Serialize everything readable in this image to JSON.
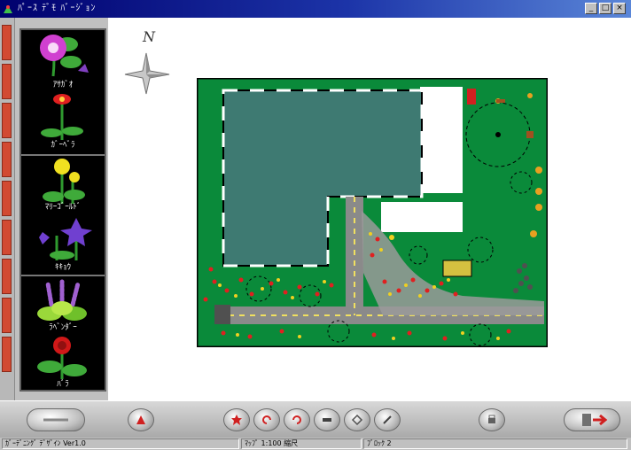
{
  "window": {
    "title": "ﾊﾟｰｽ ﾃﾞﾓ ﾊﾞｰｼﾞｮﾝ",
    "controls": {
      "minimize": "_",
      "maximize": "□",
      "close": "×"
    }
  },
  "palette": {
    "plants": [
      {
        "label": "ｱｻｶﾞｵ",
        "icon": "morning-glory-icon",
        "color": "#d040d0"
      },
      {
        "label": "ｶﾞｰﾍﾞﾗ",
        "icon": "gerbera-icon",
        "color": "#e02020"
      },
      {
        "label": "ﾏﾘｰｺﾞｰﾙﾄﾞ",
        "icon": "marigold-icon",
        "color": "#f0e020"
      },
      {
        "label": "ｷｷｮｳ",
        "icon": "bellflower-icon",
        "color": "#7040d0"
      },
      {
        "label": "ﾗﾍﾞﾝﾀﾞｰ",
        "icon": "lavender-icon",
        "color": "#a060d0"
      },
      {
        "label": "ﾊﾞﾗ",
        "icon": "rose-icon",
        "color": "#d01818"
      }
    ]
  },
  "compass": {
    "north_label": "N"
  },
  "colors": {
    "lawn": "#0a8a3a",
    "house_roof": "#3e7a72",
    "path": "#8a8a8a",
    "path_dash": "#f0e060",
    "flowers_red": "#e02020",
    "flowers_yellow": "#f0d020"
  },
  "toolbar": {
    "buttons": [
      {
        "name": "back-button",
        "icon": "back-arrow-icon"
      },
      {
        "name": "rotate-button",
        "icon": "triangle-icon"
      },
      {
        "name": "tool-place-button",
        "icon": "star-icon"
      },
      {
        "name": "tool-rotate-left-button",
        "icon": "rotate-left-icon"
      },
      {
        "name": "tool-rotate-right-button",
        "icon": "rotate-right-icon"
      },
      {
        "name": "tool-fence-button",
        "icon": "fence-icon"
      },
      {
        "name": "tool-erase-button",
        "icon": "eraser-icon"
      },
      {
        "name": "tool-pen-button",
        "icon": "pen-icon"
      },
      {
        "name": "print-button",
        "icon": "printer-icon"
      },
      {
        "name": "exit-button",
        "icon": "exit-door-icon"
      }
    ]
  },
  "status": {
    "cells": [
      "ｶﾞｰﾃﾞﾆﾝｸﾞ ﾃﾞｻﾞｲﾝ Ver1.0",
      "ﾏｯﾌﾟ 1:100 縮尺",
      "ﾌﾞﾛｯｸ 2"
    ]
  }
}
